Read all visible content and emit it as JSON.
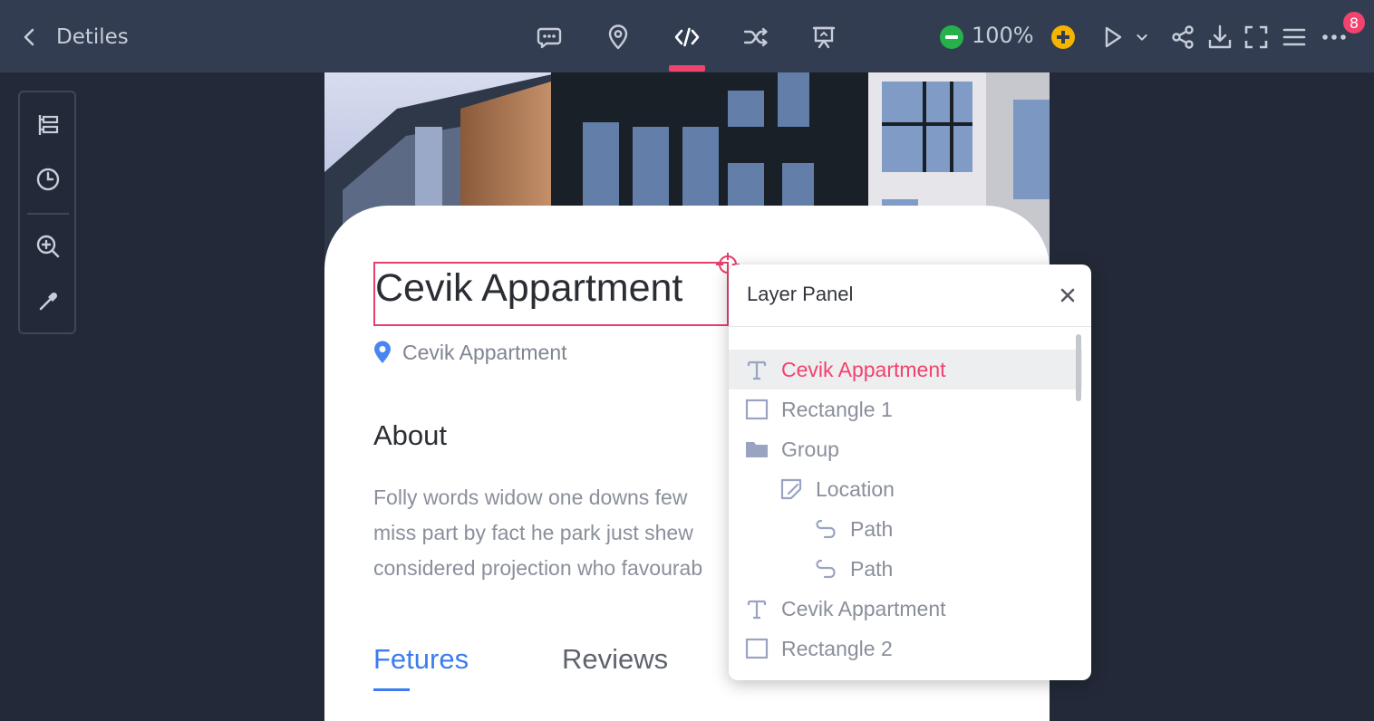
{
  "topbar": {
    "back_label": "Detiles",
    "zoom_value": "100%",
    "notification_count": "8"
  },
  "artboard": {
    "title": "Cevik Appartment",
    "location": "Cevik Appartment",
    "about_heading": "About",
    "about_lines": [
      "Folly words widow one downs few",
      "miss part by fact he park just shew",
      "considered projection who favourab"
    ],
    "tabs": [
      {
        "label": "Fetures",
        "active": true
      },
      {
        "label": "Reviews",
        "active": false
      }
    ]
  },
  "layer_panel": {
    "title": "Layer Panel",
    "items": [
      {
        "label": "Cevik Appartment",
        "icon": "text-icon",
        "selected": true
      },
      {
        "label": "Rectangle 1",
        "icon": "rectangle-icon"
      },
      {
        "label": "Group",
        "icon": "folder-icon"
      },
      {
        "label": "Location",
        "icon": "shape-icon"
      },
      {
        "label": "Path",
        "icon": "path-icon"
      },
      {
        "label": "Path",
        "icon": "path-icon"
      },
      {
        "label": "Cevik Appartment",
        "icon": "text-icon"
      },
      {
        "label": "Rectangle 2",
        "icon": "rectangle-icon"
      }
    ]
  },
  "colors": {
    "topbar_bg": "#333d51",
    "canvas_bg": "#232938",
    "accent": "#f2426e",
    "link_blue": "#3c7cf0",
    "zoom_minus": "#26b24a",
    "zoom_plus": "#f5b400"
  }
}
